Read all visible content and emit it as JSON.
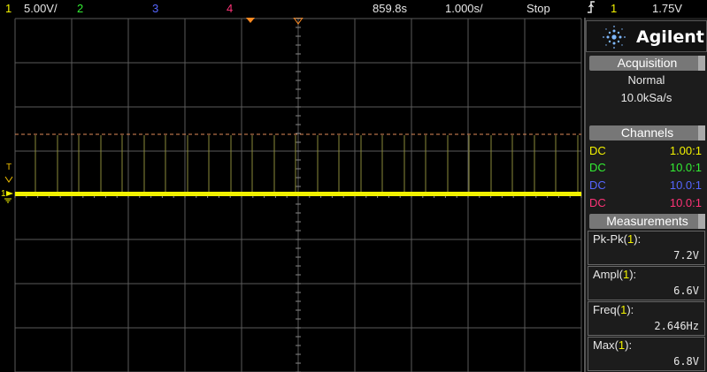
{
  "topbar": {
    "ch1_num": "1",
    "ch1_scale": "5.00V/",
    "ch2_num": "2",
    "ch3_num": "3",
    "ch4_num": "4",
    "time_offset": "859.8s",
    "time_scale": "1.000s/",
    "run_state": "Stop",
    "trigger_icon": "trigger-edge-icon",
    "trigger_channel": "1",
    "trigger_level": "1.75V"
  },
  "markers": {
    "trigger_marker": "T",
    "ch1_ground": "1"
  },
  "panel": {
    "brand": "Agilent",
    "acquisition": {
      "title": "Acquisition",
      "mode": "Normal",
      "rate": "10.0kSa/s"
    },
    "channels": {
      "title": "Channels",
      "items": [
        {
          "coupling": "DC",
          "probe": "1.00:1",
          "color": "#f2f200"
        },
        {
          "coupling": "DC",
          "probe": "10.0:1",
          "color": "#33ee33"
        },
        {
          "coupling": "DC",
          "probe": "10.0:1",
          "color": "#5566ff"
        },
        {
          "coupling": "DC",
          "probe": "10.0:1",
          "color": "#ff3377"
        }
      ]
    },
    "measurements": {
      "title": "Measurements",
      "items": [
        {
          "name": "Pk-Pk",
          "channel": "1",
          "value": "7.2V"
        },
        {
          "name": "Ampl",
          "channel": "1",
          "value": "6.6V"
        },
        {
          "name": "Freq",
          "channel": "1",
          "value": "2.646Hz"
        },
        {
          "name": "Max",
          "channel": "1",
          "value": "6.8V"
        }
      ]
    }
  },
  "colors": {
    "ch1": "#f2f200",
    "ch2": "#33ee33",
    "ch3": "#5566ff",
    "ch4": "#ff3377",
    "grid": "#5a5a5a"
  }
}
